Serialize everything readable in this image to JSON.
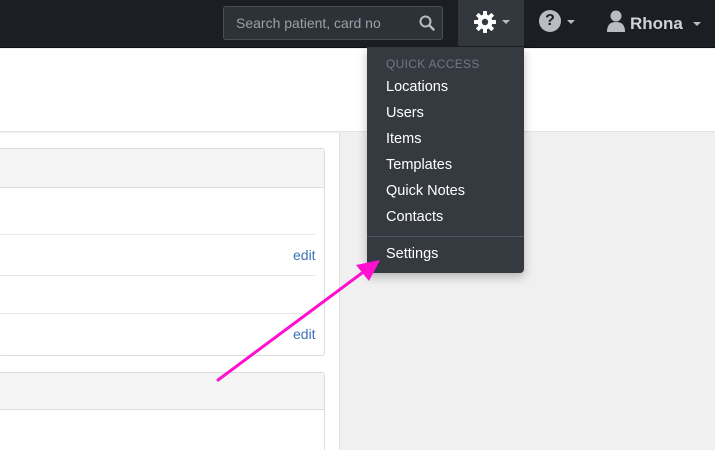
{
  "navbar": {
    "search": {
      "placeholder": "Search patient, card no"
    },
    "gear_icon": "gear-icon",
    "help_icon": "question-circle-icon",
    "help_glyph": "?",
    "user": {
      "icon": "user-icon",
      "name": "Rhona"
    }
  },
  "panel": {
    "edit_label_1": "edit",
    "edit_label_2": "edit"
  },
  "dropdown": {
    "header": "QUICK ACCESS",
    "items": [
      "Locations",
      "Users",
      "Items",
      "Templates",
      "Quick Notes",
      "Contacts"
    ],
    "settings": "Settings"
  },
  "colors": {
    "navbar_bg": "#1b1f24",
    "dropdown_bg": "#343a40",
    "link": "#3a73b5",
    "annotation_arrow": "#ff10d0"
  }
}
